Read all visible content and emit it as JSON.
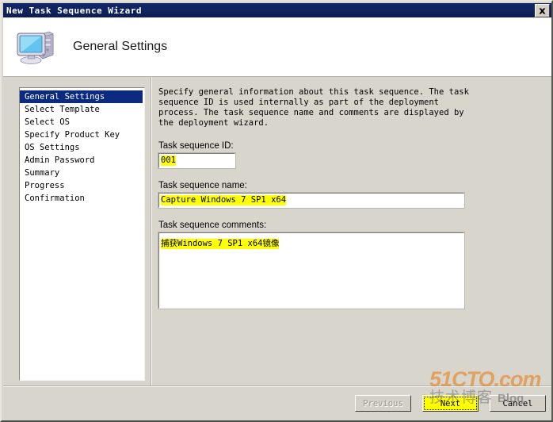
{
  "window": {
    "title": "New Task Sequence Wizard",
    "close_label": "Close"
  },
  "header": {
    "title": "General Settings",
    "icon": "computer-icon"
  },
  "sidebar": {
    "items": [
      {
        "label": "General Settings",
        "selected": true
      },
      {
        "label": "Select Template",
        "selected": false
      },
      {
        "label": "Select OS",
        "selected": false
      },
      {
        "label": "Specify Product Key",
        "selected": false
      },
      {
        "label": "OS Settings",
        "selected": false
      },
      {
        "label": "Admin Password",
        "selected": false
      },
      {
        "label": "Summary",
        "selected": false
      },
      {
        "label": "Progress",
        "selected": false
      },
      {
        "label": "Confirmation",
        "selected": false
      }
    ]
  },
  "content": {
    "instructions": "Specify general information about this task sequence.  The task sequence ID is used internally as part of the deployment process.  The task sequence name and comments are displayed by the deployment wizard.",
    "fields": {
      "id": {
        "label": "Task sequence ID:",
        "value": "001"
      },
      "name": {
        "label": "Task sequence name:",
        "value": "Capture Windows 7 SP1 x64"
      },
      "comments": {
        "label": "Task sequence comments:",
        "value": "捕获Windows 7 SP1 x64镜像"
      }
    }
  },
  "footer": {
    "previous_label": "Previous",
    "next_label": "Next",
    "cancel_label": "Cancel"
  },
  "watermark": {
    "main": "51CTO.com",
    "chinese": "技术博客",
    "blog": "Blog"
  },
  "colors": {
    "titlebar": "#10245f",
    "selection": "#0b2a80",
    "highlight": "#ffff00",
    "face": "#d8d5cd",
    "watermark_orange": "#e8821e"
  }
}
